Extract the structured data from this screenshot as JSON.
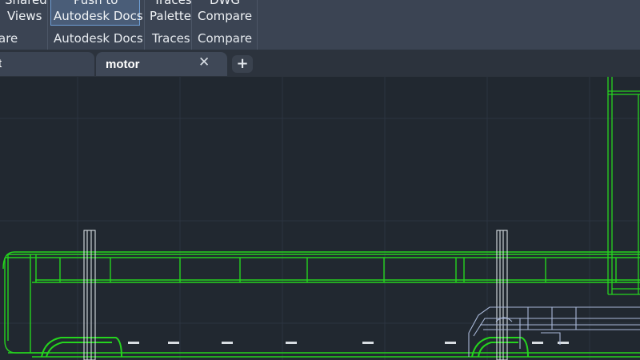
{
  "ribbon": {
    "groups": [
      {
        "name": "partial-share",
        "lines": [
          "Shared",
          "Views"
        ],
        "label": "are"
      },
      {
        "name": "autodesk-docs",
        "lines": [
          "Push to",
          "Autodesk Docs"
        ],
        "label": "Autodesk Docs"
      },
      {
        "name": "traces",
        "lines": [
          "Traces",
          "Palette"
        ],
        "label": "Traces"
      },
      {
        "name": "compare",
        "lines": [
          "DWG",
          "Compare"
        ],
        "label": "Compare"
      }
    ]
  },
  "tabs": {
    "partial_tab_label": "t",
    "active_tab_label": "motor",
    "close_glyph": "✕",
    "add_glyph": "+"
  },
  "colors": {
    "ribbon_bg": "#3b4453",
    "canvas_bg": "#212830",
    "geometry_green": "#25d41e",
    "geometry_white": "#d8dde2",
    "geometry_blue": "#a9b8d8"
  },
  "icons": {
    "close": "close-icon",
    "add": "plus-icon"
  }
}
